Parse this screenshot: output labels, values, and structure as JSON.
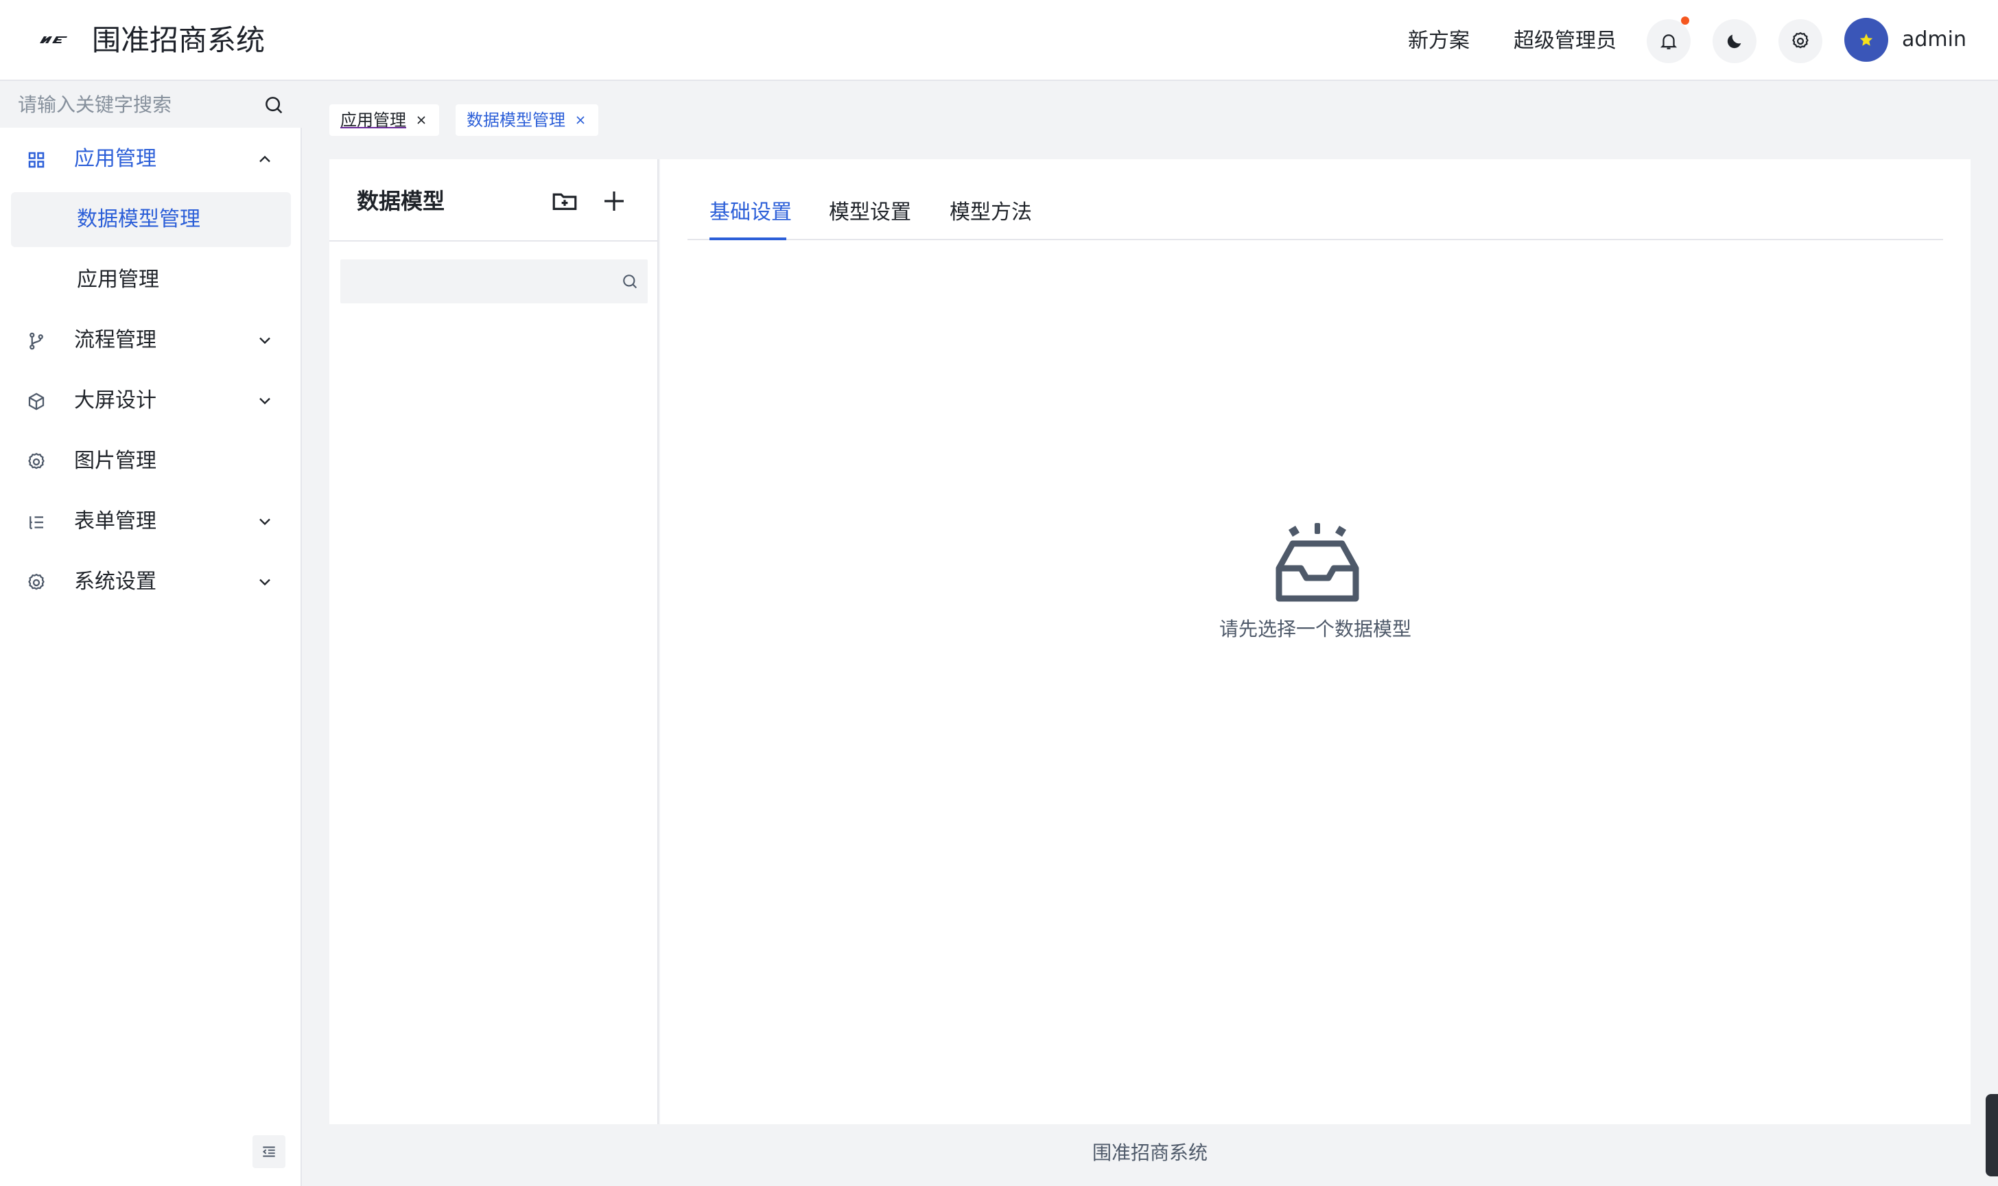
{
  "header": {
    "app_title": "围准招商系统",
    "links": [
      "新方案",
      "超级管理员"
    ],
    "username": "admin",
    "icons": [
      "bell-icon",
      "moon-icon",
      "gear-icon"
    ]
  },
  "sidebar": {
    "search_placeholder": "请输入关键字搜索",
    "menu": [
      {
        "label": "应用管理",
        "icon": "grid-icon",
        "expanded": true,
        "children": [
          {
            "label": "数据模型管理",
            "selected": true
          },
          {
            "label": "应用管理",
            "selected": false
          }
        ]
      },
      {
        "label": "流程管理",
        "icon": "branch-icon",
        "expanded": false
      },
      {
        "label": "大屏设计",
        "icon": "cube-icon",
        "expanded": false
      },
      {
        "label": "图片管理",
        "icon": "gear-icon",
        "expanded": false
      },
      {
        "label": "表单管理",
        "icon": "list-icon",
        "expanded": false
      },
      {
        "label": "系统设置",
        "icon": "gear-icon",
        "expanded": false
      }
    ]
  },
  "tabs": [
    {
      "label": "应用管理",
      "active": false
    },
    {
      "label": "数据模型管理",
      "active": true
    }
  ],
  "left_panel": {
    "title": "数据模型",
    "search_placeholder": ""
  },
  "right_panel": {
    "tabs": [
      "基础设置",
      "模型设置",
      "模型方法"
    ],
    "active_tab": "基础设置",
    "empty_text": "请先选择一个数据模型"
  },
  "footer": {
    "text": "围准招商系统"
  },
  "colors": {
    "accent": "#2c5fd8",
    "notification_dot": "#f5571f",
    "avatar_bg": "#3a56b8"
  }
}
